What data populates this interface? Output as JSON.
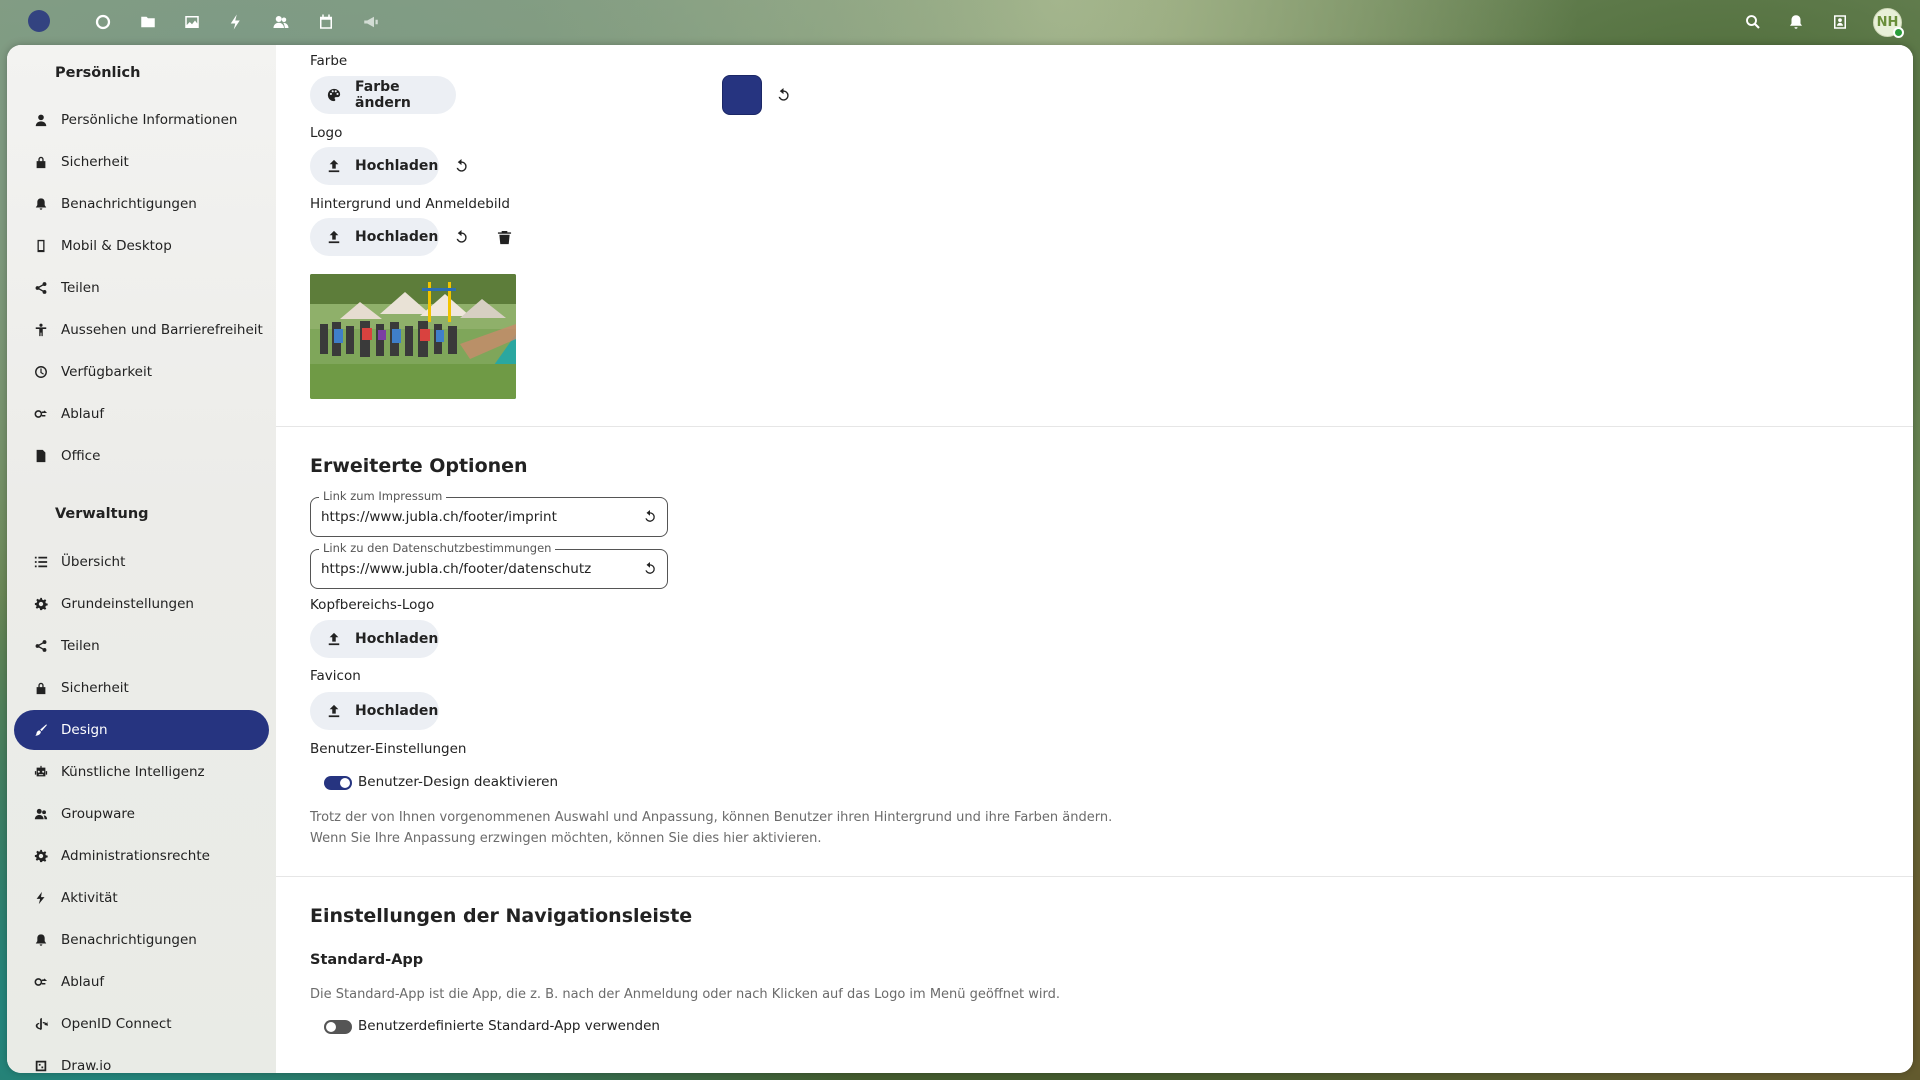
{
  "colors": {
    "primary": "#263480",
    "pill_bg": "#eceff4"
  },
  "header": {
    "avatar_initials": "NH",
    "app_icons": [
      "dashboard-icon",
      "files-icon",
      "photos-icon",
      "activity-icon",
      "contacts-icon",
      "calendar-icon",
      "announcements-icon"
    ],
    "right_icons": [
      "search-icon",
      "notifications-icon",
      "contacts-menu-icon"
    ]
  },
  "sidebar": {
    "personal_caption": "Persönlich",
    "personal_items": [
      {
        "label": "Persönliche Informationen",
        "icon": "user-icon"
      },
      {
        "label": "Sicherheit",
        "icon": "lock-icon"
      },
      {
        "label": "Benachrichtigungen",
        "icon": "bell-icon"
      },
      {
        "label": "Mobil & Desktop",
        "icon": "phone-icon"
      },
      {
        "label": "Teilen",
        "icon": "share-icon"
      },
      {
        "label": "Aussehen und Barrierefreiheit",
        "icon": "accessibility-icon"
      },
      {
        "label": "Verfügbarkeit",
        "icon": "clock-icon"
      },
      {
        "label": "Ablauf",
        "icon": "flow-icon"
      },
      {
        "label": "Office",
        "icon": "document-icon"
      }
    ],
    "admin_caption": "Verwaltung",
    "admin_items": [
      {
        "label": "Übersicht",
        "icon": "list-icon"
      },
      {
        "label": "Grundeinstellungen",
        "icon": "gear-icon"
      },
      {
        "label": "Teilen",
        "icon": "share-icon"
      },
      {
        "label": "Sicherheit",
        "icon": "lock-icon"
      },
      {
        "label": "Design",
        "icon": "paint-icon",
        "active": true
      },
      {
        "label": "Künstliche Intelligenz",
        "icon": "robot-icon"
      },
      {
        "label": "Groupware",
        "icon": "group-icon"
      },
      {
        "label": "Administrationsrechte",
        "icon": "admin-gear-icon"
      },
      {
        "label": "Aktivität",
        "icon": "lightning-icon"
      },
      {
        "label": "Benachrichtigungen",
        "icon": "bell-icon"
      },
      {
        "label": "Ablauf",
        "icon": "flow-icon"
      },
      {
        "label": "OpenID Connect",
        "icon": "openid-icon"
      },
      {
        "label": "Draw.io",
        "icon": "drawio-icon"
      }
    ]
  },
  "theming": {
    "color_label": "Farbe",
    "color_button": "Farbe ändern",
    "logo_label": "Logo",
    "upload_label": "Hochladen",
    "background_label": "Hintergrund und Anmeldebild"
  },
  "advanced": {
    "title": "Erweiterte Optionen",
    "imprint_legend": "Link zum Impressum",
    "imprint_value": "https://www.jubla.ch/footer/imprint",
    "privacy_legend": "Link zu den Datenschutzbestimmungen",
    "privacy_value": "https://www.jubla.ch/footer/datenschutz",
    "header_logo_label": "Kopfbereichs-Logo",
    "favicon_label": "Favicon",
    "user_settings_label": "Benutzer-Einstellungen",
    "disable_user_theming_label": "Benutzer-Design deaktivieren",
    "disable_user_theming_on": true,
    "hint_line1": "Trotz der von Ihnen vorgenommenen Auswahl und Anpassung, können Benutzer ihren Hintergrund und ihre Farben ändern.",
    "hint_line2": "Wenn Sie Ihre Anpassung erzwingen möchten, können Sie dies hier aktivieren."
  },
  "navigation": {
    "title": "Einstellungen der Navigationsleiste",
    "default_app_title": "Standard-App",
    "default_app_hint": "Die Standard-App ist die App, die z. B. nach der Anmeldung oder nach Klicken auf das Logo im Menü geöffnet wird.",
    "custom_default_app_label": "Benutzerdefinierte Standard-App verwenden",
    "custom_default_app_on": false
  }
}
